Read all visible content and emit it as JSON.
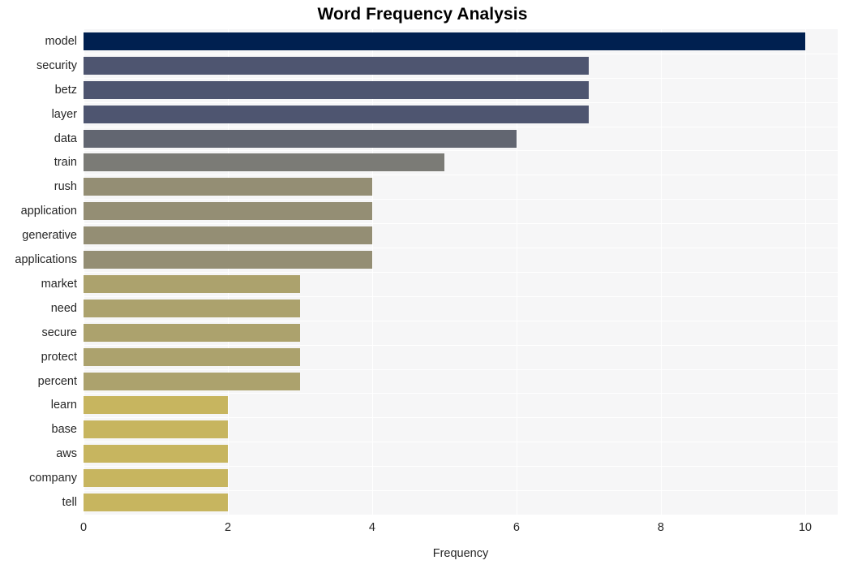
{
  "chart_data": {
    "type": "bar",
    "orientation": "horizontal",
    "title": "Word Frequency Analysis",
    "xlabel": "Frequency",
    "ylabel": "",
    "categories": [
      "model",
      "security",
      "betz",
      "layer",
      "data",
      "train",
      "rush",
      "application",
      "generative",
      "applications",
      "market",
      "need",
      "secure",
      "protect",
      "percent",
      "learn",
      "base",
      "aws",
      "company",
      "tell"
    ],
    "values": [
      10,
      7,
      7,
      7,
      6,
      5,
      4,
      4,
      4,
      4,
      3,
      3,
      3,
      3,
      3,
      2,
      2,
      2,
      2,
      2
    ],
    "bar_colors": [
      "#002050",
      "#4e5570",
      "#4e5570",
      "#4e5570",
      "#626671",
      "#7b7b76",
      "#948e74",
      "#948e74",
      "#948e74",
      "#948e74",
      "#aca26d",
      "#aca26d",
      "#aca26d",
      "#aca26d",
      "#aca26d",
      "#c7b55f",
      "#c7b55f",
      "#c7b55f",
      "#c7b55f",
      "#c7b55f"
    ],
    "xlim": [
      0,
      10.45
    ],
    "ylim_note": "categorical, 20 bars ordered descending by frequency",
    "xticks": [
      0,
      2,
      4,
      6,
      8,
      10
    ],
    "xtick_labels": [
      "0",
      "2",
      "4",
      "6",
      "8",
      "10"
    ],
    "grid": true,
    "grid_color": "#ffffff",
    "plot_background": "#f6f6f7",
    "figure_background": "#ffffff",
    "legend": null,
    "colormap": "cividis"
  }
}
